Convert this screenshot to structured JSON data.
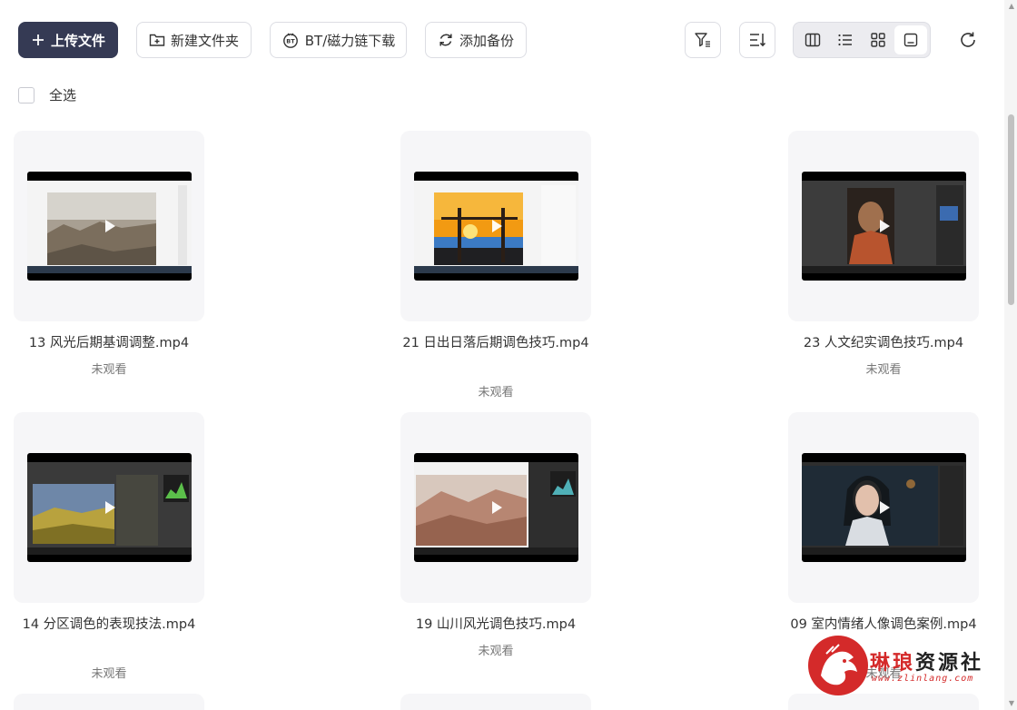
{
  "toolbar": {
    "upload_label": "上传文件",
    "new_folder_label": "新建文件夹",
    "bt_label": "BT/磁力链下载",
    "backup_label": "添加备份"
  },
  "select_all_label": "全选",
  "files": [
    {
      "name": "13 风光后期基调调整.mp4",
      "status": "未观看"
    },
    {
      "name": "21 日出日落后期调色技巧.mp4",
      "status": "未观看"
    },
    {
      "name": "23 人文纪实调色技巧.mp4",
      "status": "未观看"
    },
    {
      "name": "14 分区调色的表现技法.mp4",
      "status": "未观看"
    },
    {
      "name": "19 山川风光调色技巧.mp4",
      "status": "未观看"
    },
    {
      "name": "09 室内情绪人像调色案例.mp4",
      "status": "未观看"
    }
  ],
  "watermark": {
    "name_a": "琳琅",
    "name_b": "资源社",
    "url": "www.zlinlang.com"
  },
  "colors": {
    "primary": "#353a54",
    "card_bg": "#f6f6f8",
    "watermark_red": "#d42a2a"
  }
}
